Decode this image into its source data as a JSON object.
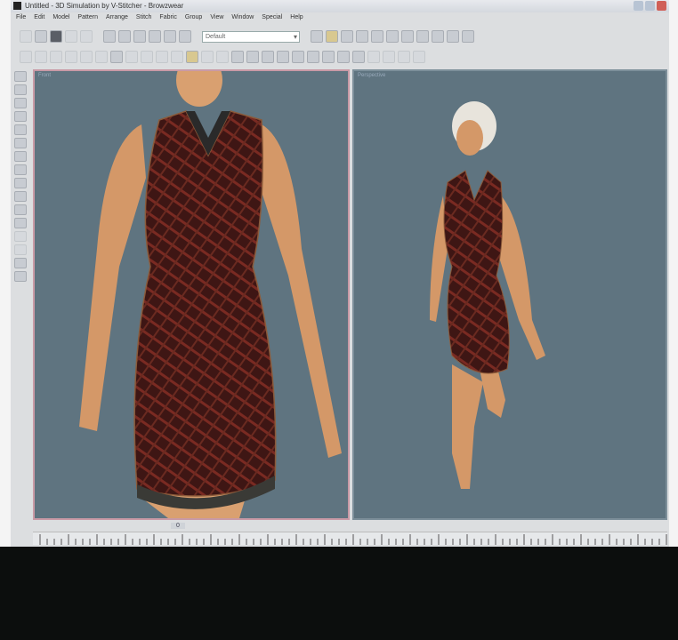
{
  "window": {
    "title": "Untitled - 3D Simulation by V-Stitcher - Browzwear",
    "minimize": "_",
    "close": "x"
  },
  "menu": [
    "File",
    "Edit",
    "Model",
    "Pattern",
    "Arrange",
    "Stitch",
    "Fabric",
    "Group",
    "View",
    "Window",
    "Special",
    "Help"
  ],
  "toolbar": {
    "combo_value": "Default"
  },
  "viewports": {
    "left_label": "Front",
    "right_label": "Perspective"
  },
  "timeline": {
    "label": "0"
  },
  "colors": {
    "viewport_bg": "#5f7480",
    "dress": "#4a1a18",
    "skin": "#d9a070"
  }
}
